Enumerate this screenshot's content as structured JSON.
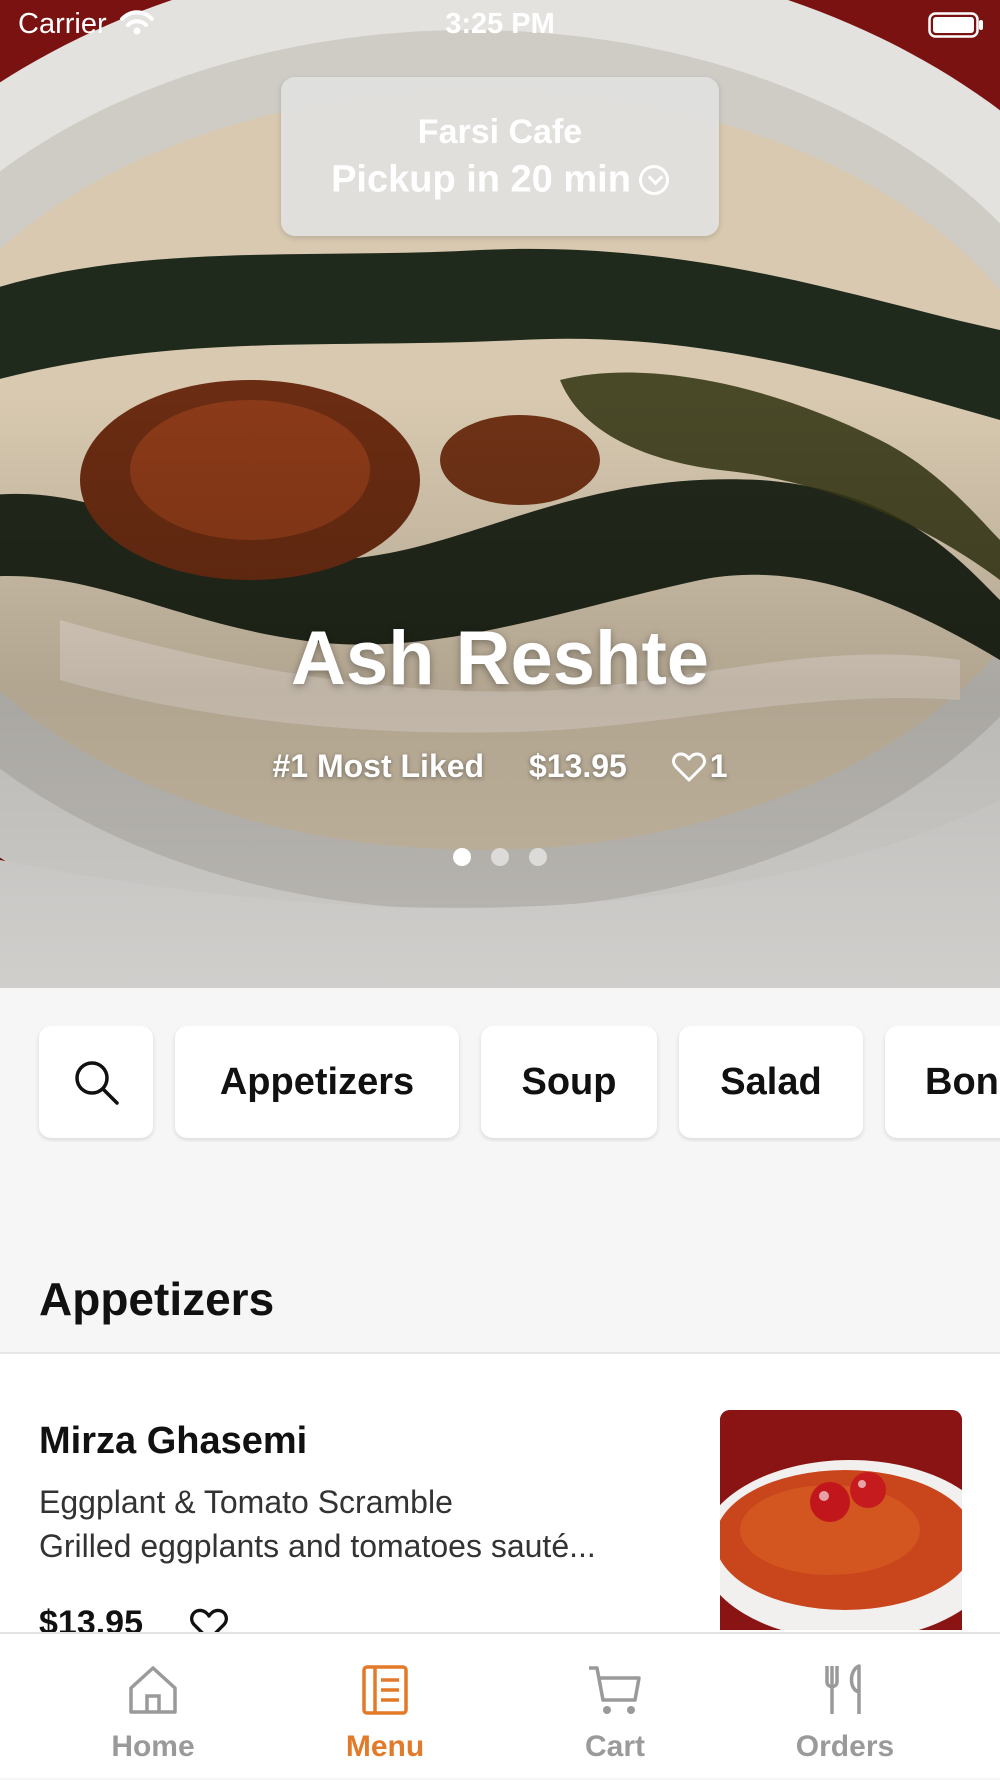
{
  "status_bar": {
    "carrier": "Carrier",
    "time": "3:25 PM"
  },
  "pickup": {
    "store_name": "Farsi Cafe",
    "eta": "Pickup in 20 min"
  },
  "featured": {
    "name": "Ash Reshte",
    "rank": "#1 Most Liked",
    "price": "$13.95",
    "likes": "1",
    "page_count": 3,
    "page_index": 1
  },
  "categories": {
    "search_icon": "search-icon",
    "items": [
      "Appetizers",
      "Soup",
      "Salad",
      "Bon"
    ]
  },
  "section": {
    "title": "Appetizers"
  },
  "menu_items": [
    {
      "name": "Mirza Ghasemi",
      "description": "Eggplant & Tomato Scramble\n Grilled eggplants and tomatoes sauté...",
      "price": "$13.95"
    }
  ],
  "tabbar": {
    "tabs": [
      {
        "label": "Home",
        "icon": "home-icon",
        "active": false
      },
      {
        "label": "Menu",
        "icon": "menu-icon",
        "active": true
      },
      {
        "label": "Cart",
        "icon": "cart-icon",
        "active": false
      },
      {
        "label": "Orders",
        "icon": "utensils-icon",
        "active": false
      }
    ]
  },
  "colors": {
    "accent": "#e27a2a",
    "inactive": "#9a9a9a",
    "hero_bg": "#7a1212"
  }
}
